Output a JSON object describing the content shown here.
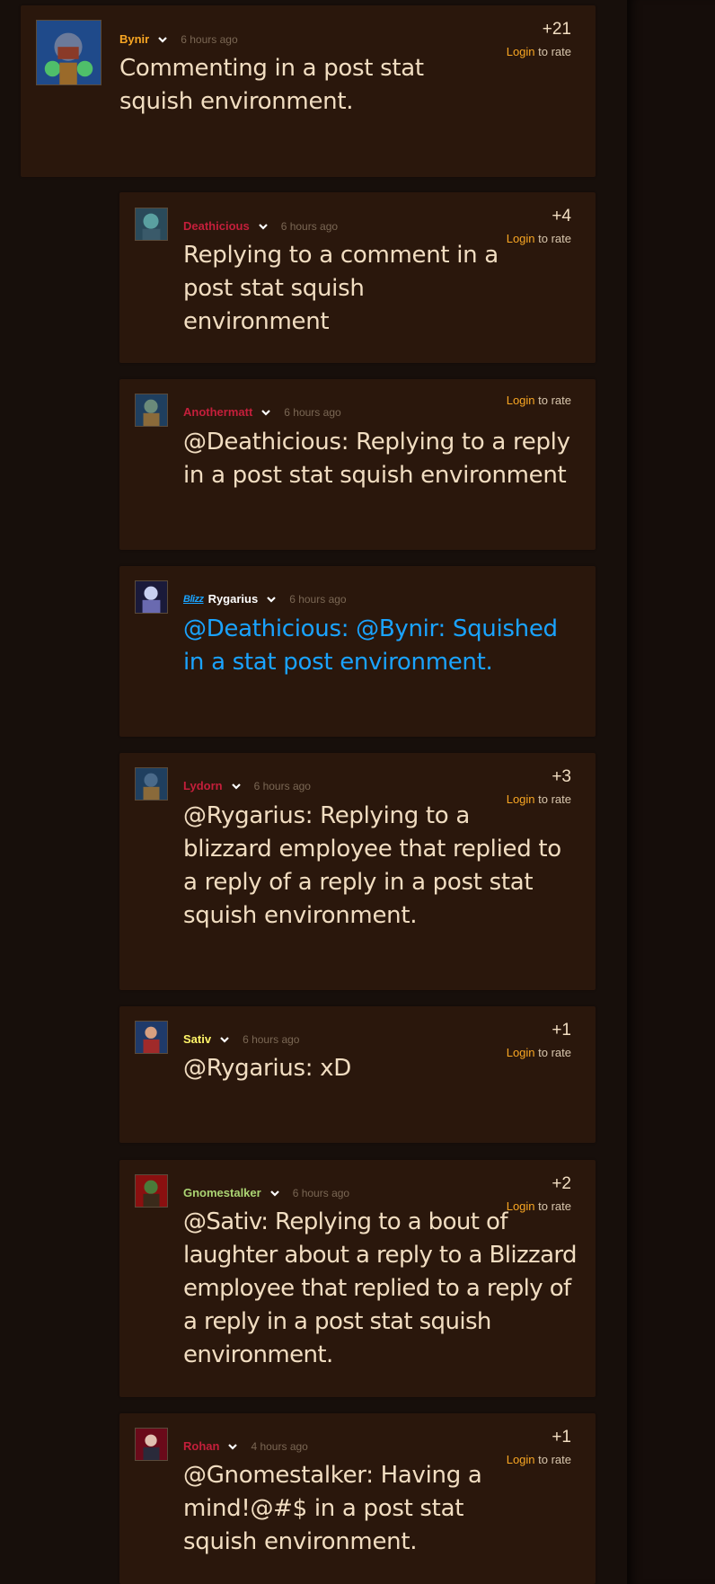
{
  "rate": {
    "login_label": "Login",
    "suffix": " to rate"
  },
  "blizz_badge": "Blizz",
  "comments": [
    {
      "author": "Bynir",
      "author_color": "#f8a623",
      "time": "6 hours ago",
      "score": "+21",
      "text": "Commenting in a post stat squish environment.",
      "avatar_icon": "gnome-portrait-icon"
    },
    {
      "author": "Deathicious",
      "author_color": "#c41f3b",
      "time": "6 hours ago",
      "score": "+4",
      "text": "Replying to a comment in a post stat squish environment",
      "avatar_icon": "undead-portrait-icon"
    },
    {
      "author": "Anothermatt",
      "author_color": "#c41f3b",
      "time": "6 hours ago",
      "score": "",
      "text": "@Deathicious: Replying to a reply in a post stat squish environment",
      "avatar_icon": "troll-portrait-icon"
    },
    {
      "author": "Rygarius",
      "author_color": "#ffffff",
      "time": "6 hours ago",
      "score": "",
      "text": "@Deathicious: @Bynir: Squished in a stat post environment.",
      "avatar_icon": "blizzard-portrait-icon",
      "text_color": "#1aa3ff"
    },
    {
      "author": "Lydorn",
      "author_color": "#c41f3b",
      "time": "6 hours ago",
      "score": "+3",
      "text": "@Rygarius: Replying to a blizzard employee that replied to a reply of a reply in a post stat squish environment.",
      "avatar_icon": "troll-portrait-icon"
    },
    {
      "author": "Sativ",
      "author_color": "#fff569",
      "time": "6 hours ago",
      "score": "+1",
      "text": "@Rygarius: xD",
      "avatar_icon": "human-portrait-icon"
    },
    {
      "author": "Gnomestalker",
      "author_color": "#abd473",
      "time": "6 hours ago",
      "score": "+2",
      "text": "@Sativ: Replying to a bout of laughter about a reply to a Blizzard employee that replied to a reply of a reply in a post stat squish environment.",
      "avatar_icon": "orc-portrait-icon"
    },
    {
      "author": "Rohan",
      "author_color": "#c41f3b",
      "time": "4 hours ago",
      "score": "+1",
      "text": "@Gnomestalker: Having a mind!@#$ in a post stat squish environment.",
      "avatar_icon": "blood-elf-portrait-icon"
    }
  ]
}
